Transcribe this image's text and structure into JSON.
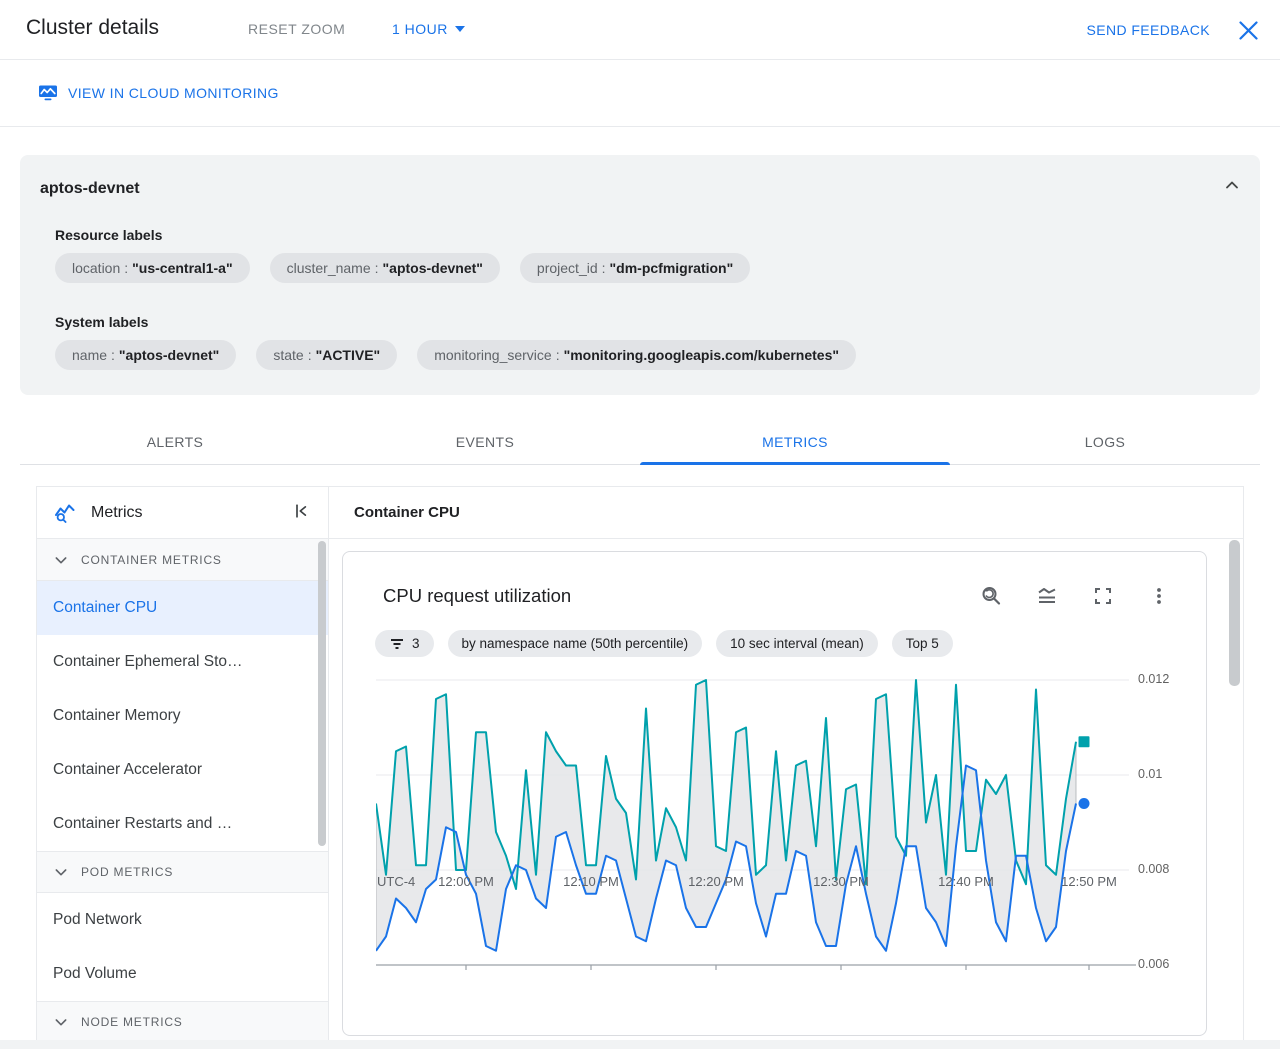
{
  "colors": {
    "accent": "#1A73E8",
    "series_teal": "#00A1AC",
    "series_blue": "#1A73E8",
    "selected_bg": "#E8F0FE",
    "band_fill": "#E4E5E7",
    "band_stroke": "#A9ADB2",
    "grid": "#E8EAED",
    "axis": "#9AA0A6"
  },
  "header": {
    "title": "Cluster details",
    "reset_zoom": "RESET ZOOM",
    "time_range": "1 HOUR",
    "send_feedback": "SEND FEEDBACK"
  },
  "monitoring_link": {
    "label": "VIEW IN CLOUD MONITORING"
  },
  "cluster_card": {
    "title": "aptos-devnet",
    "resource_labels_title": "Resource labels",
    "resource_labels": [
      {
        "key": "location",
        "value": "\"us-central1-a\""
      },
      {
        "key": "cluster_name",
        "value": "\"aptos-devnet\""
      },
      {
        "key": "project_id",
        "value": "\"dm-pcfmigration\""
      }
    ],
    "system_labels_title": "System labels",
    "system_labels": [
      {
        "key": "name",
        "value": "\"aptos-devnet\""
      },
      {
        "key": "state",
        "value": "\"ACTIVE\""
      },
      {
        "key": "monitoring_service",
        "value": "\"monitoring.googleapis.com/kubernetes\""
      }
    ]
  },
  "tabs": [
    {
      "label": "ALERTS",
      "active": false
    },
    {
      "label": "EVENTS",
      "active": false
    },
    {
      "label": "METRICS",
      "active": true
    },
    {
      "label": "LOGS",
      "active": false
    }
  ],
  "sidebar": {
    "title": "Metrics",
    "sections": [
      {
        "label": "CONTAINER METRICS",
        "items": [
          {
            "label": "Container CPU",
            "selected": true
          },
          {
            "label": "Container Ephemeral Sto…",
            "selected": false
          },
          {
            "label": "Container Memory",
            "selected": false
          },
          {
            "label": "Container Accelerator",
            "selected": false
          },
          {
            "label": "Container Restarts and …",
            "selected": false
          }
        ]
      },
      {
        "label": "POD METRICS",
        "items": [
          {
            "label": "Pod Network",
            "selected": false
          },
          {
            "label": "Pod Volume",
            "selected": false
          }
        ]
      },
      {
        "label": "NODE METRICS",
        "items": []
      }
    ]
  },
  "panel": {
    "title": "Container CPU"
  },
  "chart": {
    "title": "CPU request utilization",
    "chips": [
      {
        "icon": "filter",
        "label": "3"
      },
      {
        "icon": null,
        "label": "by namespace name (50th percentile)"
      },
      {
        "icon": null,
        "label": "10 sec interval (mean)"
      },
      {
        "icon": null,
        "label": "Top 5"
      }
    ],
    "toolbar": [
      {
        "icon": "zoom-reset"
      },
      {
        "icon": "stacked-chart"
      },
      {
        "icon": "fullscreen"
      },
      {
        "icon": "more-options"
      }
    ]
  },
  "chart_data": {
    "type": "line",
    "title": "CPU request utilization",
    "grid": "horizontal",
    "legend_position": "none",
    "timezone_label": "UTC-4",
    "x_ticks": [
      "12:00 PM",
      "12:10 PM",
      "12:20 PM",
      "12:30 PM",
      "12:40 PM",
      "12:50 PM"
    ],
    "x_tick_interval": "10 min",
    "sample_interval_min": 0.8,
    "y_ticks": [
      0.012,
      0.01,
      0.008,
      0.006
    ],
    "y_tick_labels": [
      "0.012",
      "0.01",
      "0.008",
      "0.006"
    ],
    "ylim": [
      0.006,
      0.0126
    ],
    "band": {
      "between": [
        "series-teal",
        "series-blue"
      ],
      "fill": "#E4E5E7",
      "stroke": "#A9ADB2"
    },
    "series": [
      {
        "name": "series-teal",
        "color": "#00A1AC",
        "end_marker": "square",
        "values": [
          0.0094,
          0.0079,
          0.0105,
          0.0106,
          0.0081,
          0.0081,
          0.0116,
          0.0117,
          0.008,
          0.008,
          0.0109,
          0.0109,
          0.0088,
          0.0083,
          0.0076,
          0.0101,
          0.0079,
          0.0109,
          0.0105,
          0.0102,
          0.0102,
          0.0081,
          0.0081,
          0.0104,
          0.0095,
          0.0092,
          0.0078,
          0.0114,
          0.0082,
          0.0093,
          0.0089,
          0.0082,
          0.0119,
          0.012,
          0.0085,
          0.0084,
          0.0109,
          0.011,
          0.0079,
          0.0081,
          0.0105,
          0.0082,
          0.0102,
          0.0103,
          0.0085,
          0.0112,
          0.0078,
          0.0097,
          0.0098,
          0.0077,
          0.0116,
          0.0117,
          0.0087,
          0.0083,
          0.012,
          0.009,
          0.01,
          0.0079,
          0.0119,
          0.0084,
          0.0084,
          0.0099,
          0.0096,
          0.01,
          0.0082,
          0.0077,
          0.0118,
          0.0081,
          0.0079,
          0.0095,
          0.0107
        ]
      },
      {
        "name": "series-blue",
        "color": "#1A73E8",
        "end_marker": "circle",
        "values": [
          0.0063,
          0.0066,
          0.0074,
          0.0072,
          0.0069,
          0.0076,
          0.0078,
          0.0089,
          0.0088,
          0.0079,
          0.0075,
          0.0064,
          0.0063,
          0.0076,
          0.0081,
          0.008,
          0.0074,
          0.0072,
          0.0087,
          0.0088,
          0.0081,
          0.0075,
          0.0075,
          0.0083,
          0.0082,
          0.0074,
          0.0066,
          0.0065,
          0.0074,
          0.0082,
          0.0081,
          0.0072,
          0.0068,
          0.0068,
          0.0073,
          0.0078,
          0.0086,
          0.0085,
          0.0073,
          0.0066,
          0.0075,
          0.0075,
          0.0084,
          0.0083,
          0.0069,
          0.0064,
          0.0064,
          0.0077,
          0.0085,
          0.0075,
          0.0066,
          0.0063,
          0.0073,
          0.0085,
          0.0085,
          0.0072,
          0.0069,
          0.0064,
          0.0085,
          0.0102,
          0.0101,
          0.0082,
          0.0069,
          0.0065,
          0.0083,
          0.0083,
          0.0072,
          0.0065,
          0.0068,
          0.0084,
          0.0094
        ]
      }
    ]
  }
}
